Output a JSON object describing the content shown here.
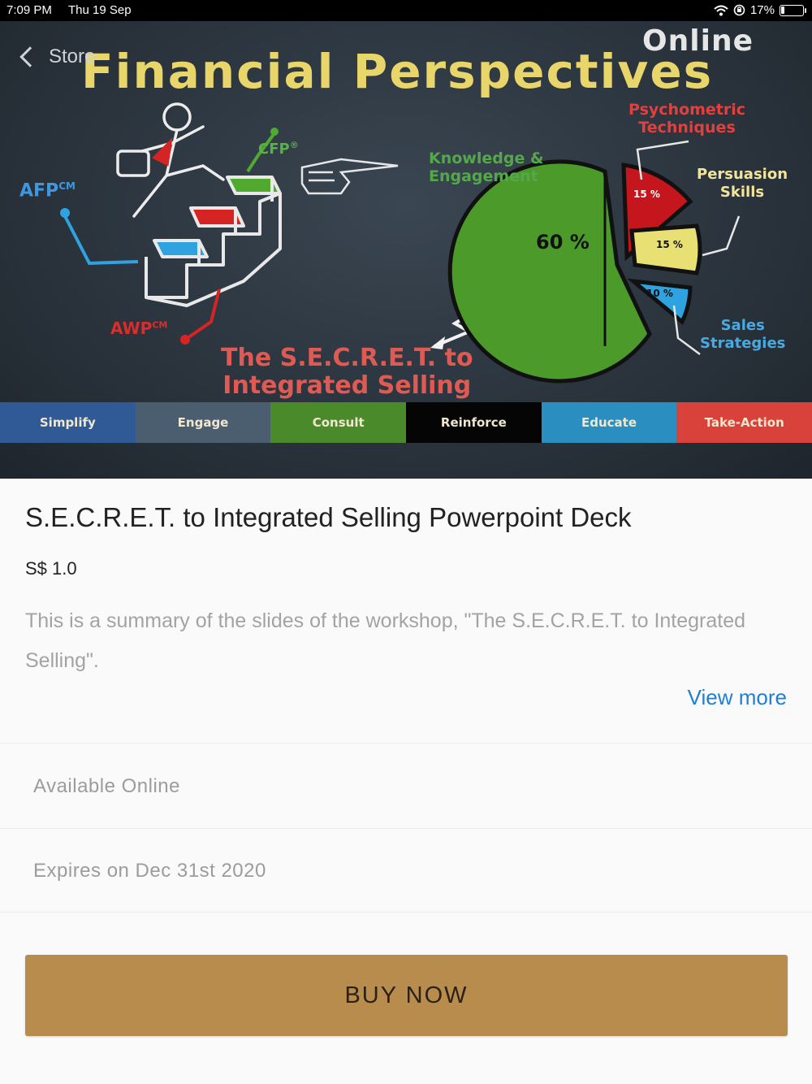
{
  "status_bar": {
    "time": "7:09 PM",
    "date": "Thu 19 Sep",
    "battery_text": "17%",
    "battery_level": 0.17
  },
  "nav": {
    "back_label": "Store"
  },
  "banner": {
    "online": "Online",
    "title": "Financial Perspectives",
    "labels": {
      "psychometric_line1": "Psychometric",
      "psychometric_line2": "Techniques",
      "persuasion_line1": "Persuasion",
      "persuasion_line2": "Skills",
      "knowledge_line1": "Knowledge &",
      "knowledge_line2": "Engagement",
      "afp": "AFP",
      "afp_sup": "CM",
      "cfp": "CFP",
      "cfp_sup": "®",
      "awp": "AWP",
      "awp_sup": "CM",
      "sales_line1": "Sales",
      "sales_line2": "Strategies",
      "secret_line1": "The S.E.C.R.E.T. to",
      "secret_line2": "Integrated Selling"
    },
    "pie_labels": {
      "p60": "60 %",
      "p15a": "15 %",
      "p15b": "15 %",
      "p10": "10 %"
    },
    "segments": [
      {
        "label": "Simplify",
        "color": "#2f5a96"
      },
      {
        "label": "Engage",
        "color": "#4b5e70"
      },
      {
        "label": "Consult",
        "color": "#4b8a2b"
      },
      {
        "label": "Reinforce",
        "color": "#050505"
      },
      {
        "label": "Educate",
        "color": "#2a8fc0"
      },
      {
        "label": "Take-Action",
        "color": "#d8423a"
      }
    ]
  },
  "product": {
    "title": "S.E.C.R.E.T. to Integrated Selling Powerpoint Deck",
    "price": "S$ 1.0",
    "description": "This is a summary of the slides of the workshop, \"The S.E.C.R.E.T. to Integrated Selling\".",
    "view_more": "View more",
    "availability": "Available Online",
    "expiry": "Expires on Dec 31st 2020",
    "buy_label": "BUY NOW"
  },
  "colors": {
    "accent_button": "#b88c4d",
    "link": "#1e7fd6"
  }
}
